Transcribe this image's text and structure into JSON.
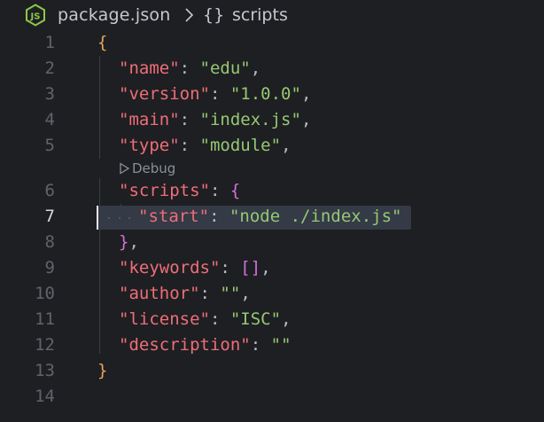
{
  "breadcrumb": {
    "file_icon": "nodejs-icon",
    "file_name": "package.json",
    "separator_icon": "chevron-right-icon",
    "symbol_icon": "{}",
    "symbol_name": "scripts"
  },
  "editor": {
    "active_line": "7",
    "codelens": "Debug",
    "line_numbers": [
      "1",
      "2",
      "3",
      "4",
      "5",
      "6",
      "7",
      "8",
      "9",
      "10",
      "11",
      "12",
      "13",
      "14"
    ],
    "lines": [
      {
        "open": "{"
      },
      {
        "key": "\"name\"",
        "value": "\"edu\"",
        "end": ","
      },
      {
        "key": "\"version\"",
        "value": "\"1.0.0\"",
        "end": ","
      },
      {
        "key": "\"main\"",
        "value": "\"index.js\"",
        "end": ","
      },
      {
        "key": "\"type\"",
        "value": "\"module\"",
        "end": ","
      },
      {
        "key": "\"scripts\"",
        "value": "{"
      },
      {
        "key": "\"start\"",
        "value": "\"node ./index.js\""
      },
      {
        "close": "}",
        "end": ","
      },
      {
        "key": "\"keywords\"",
        "value": "[]",
        "end": ","
      },
      {
        "key": "\"author\"",
        "value": "\"\"",
        "end": ","
      },
      {
        "key": "\"license\"",
        "value": "\"ISC\"",
        "end": ","
      },
      {
        "key": "\"description\"",
        "value": "\"\""
      },
      {
        "close": "}"
      }
    ],
    "colon": ":"
  }
}
